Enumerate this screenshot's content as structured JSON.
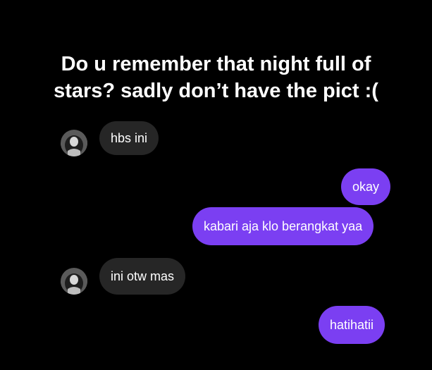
{
  "caption": {
    "line1": "Do u remember that night full of",
    "line2": "stars? sadly don’t have the pict :("
  },
  "colors": {
    "background": "#000000",
    "incoming_bubble": "#262626",
    "outgoing_bubble": "#7b3ff2",
    "text": "#ffffff"
  },
  "messages": [
    {
      "side": "incoming",
      "text": "hbs ini",
      "avatar_icon": "user-avatar-icon"
    },
    {
      "side": "outgoing",
      "text": "okay"
    },
    {
      "side": "outgoing",
      "text": "kabari aja klo berangkat yaa"
    },
    {
      "side": "incoming",
      "text": "ini otw mas",
      "avatar_icon": "user-avatar-icon"
    },
    {
      "side": "outgoing",
      "text": "hatihatii"
    }
  ]
}
